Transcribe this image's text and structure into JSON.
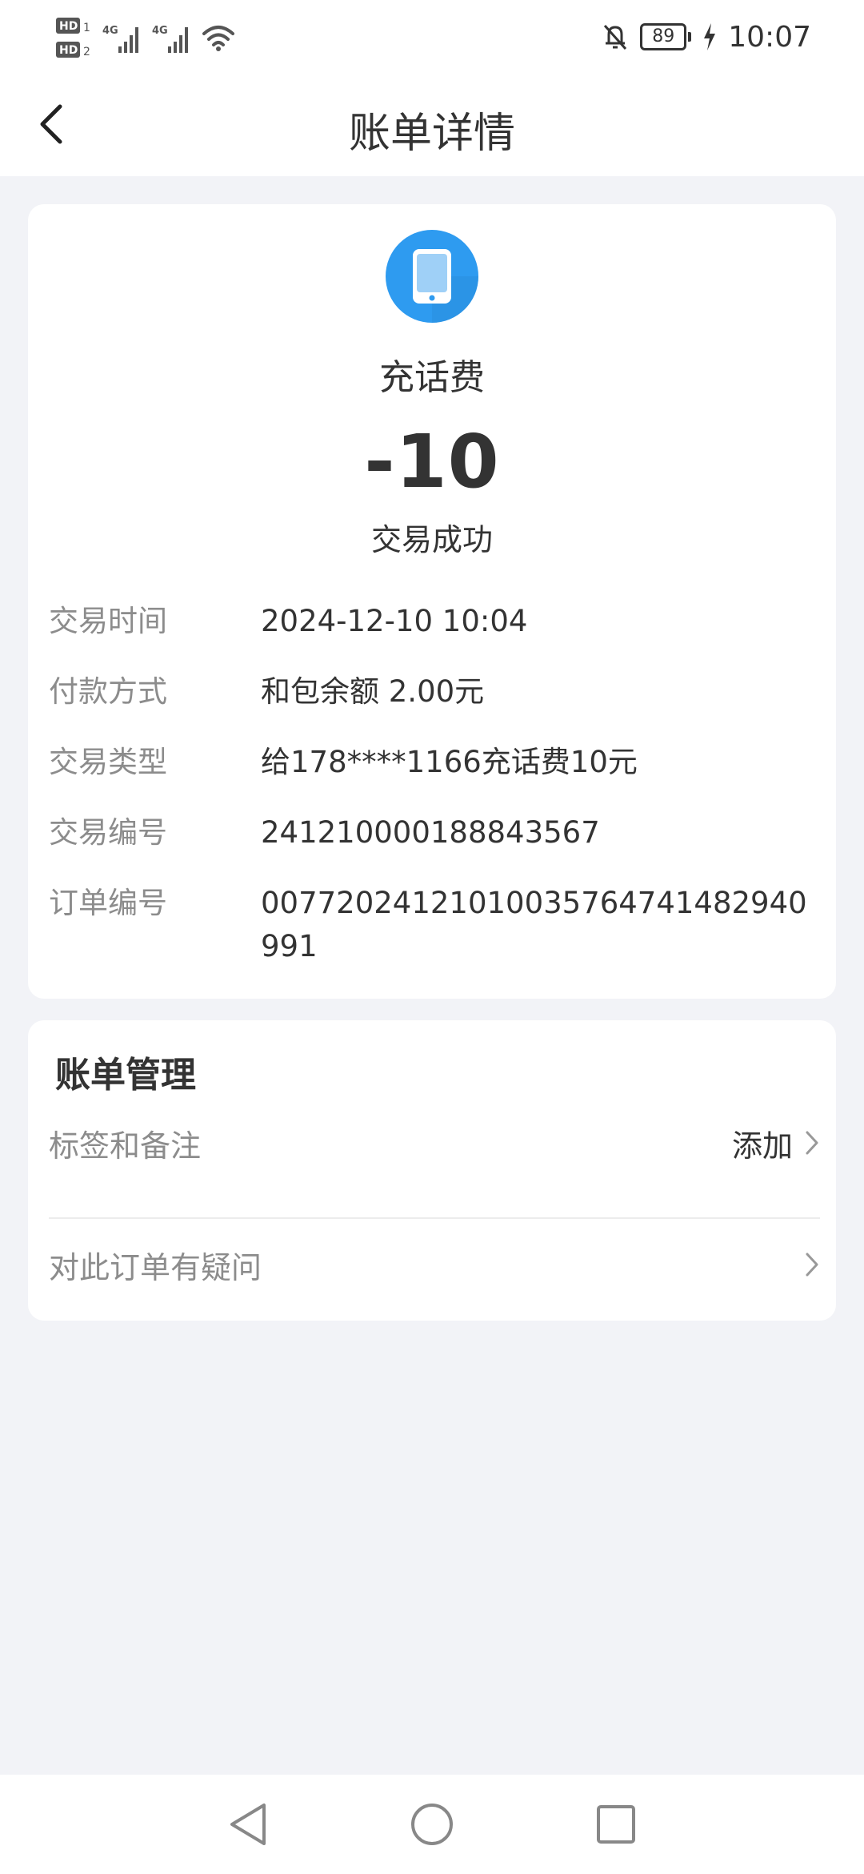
{
  "status_bar": {
    "sim1": "HD1",
    "sim2": "HD2",
    "network1": "4G",
    "network2": "4G",
    "battery_level": "89",
    "time": "10:07",
    "icons": [
      "signal-icon",
      "wifi-icon",
      "mute-bell-icon",
      "battery-icon",
      "charging-icon"
    ]
  },
  "nav": {
    "title": "账单详情",
    "back_icon": "back-chevron-icon"
  },
  "transaction": {
    "icon": "phone-icon",
    "icon_color": "#2e9bf0",
    "name": "充话费",
    "amount": "-10",
    "status": "交易成功",
    "details": [
      {
        "label": "交易时间",
        "value": "2024-12-10 10:04"
      },
      {
        "label": "付款方式",
        "value": "和包余额 2.00元"
      },
      {
        "label": "交易类型",
        "value": "给178****1166充话费10元"
      },
      {
        "label": "交易编号",
        "value": "241210000188843567"
      },
      {
        "label": "订单编号",
        "value": "00772024121010035764741482940991"
      }
    ]
  },
  "manage": {
    "title": "账单管理",
    "rows": [
      {
        "label": "标签和备注",
        "action": "添加"
      },
      {
        "label": "对此订单有疑问",
        "action": ""
      }
    ]
  },
  "colors": {
    "background": "#f2f3f7",
    "card": "#ffffff",
    "label_gray": "#8c8c8c",
    "text_dark": "#333333"
  }
}
